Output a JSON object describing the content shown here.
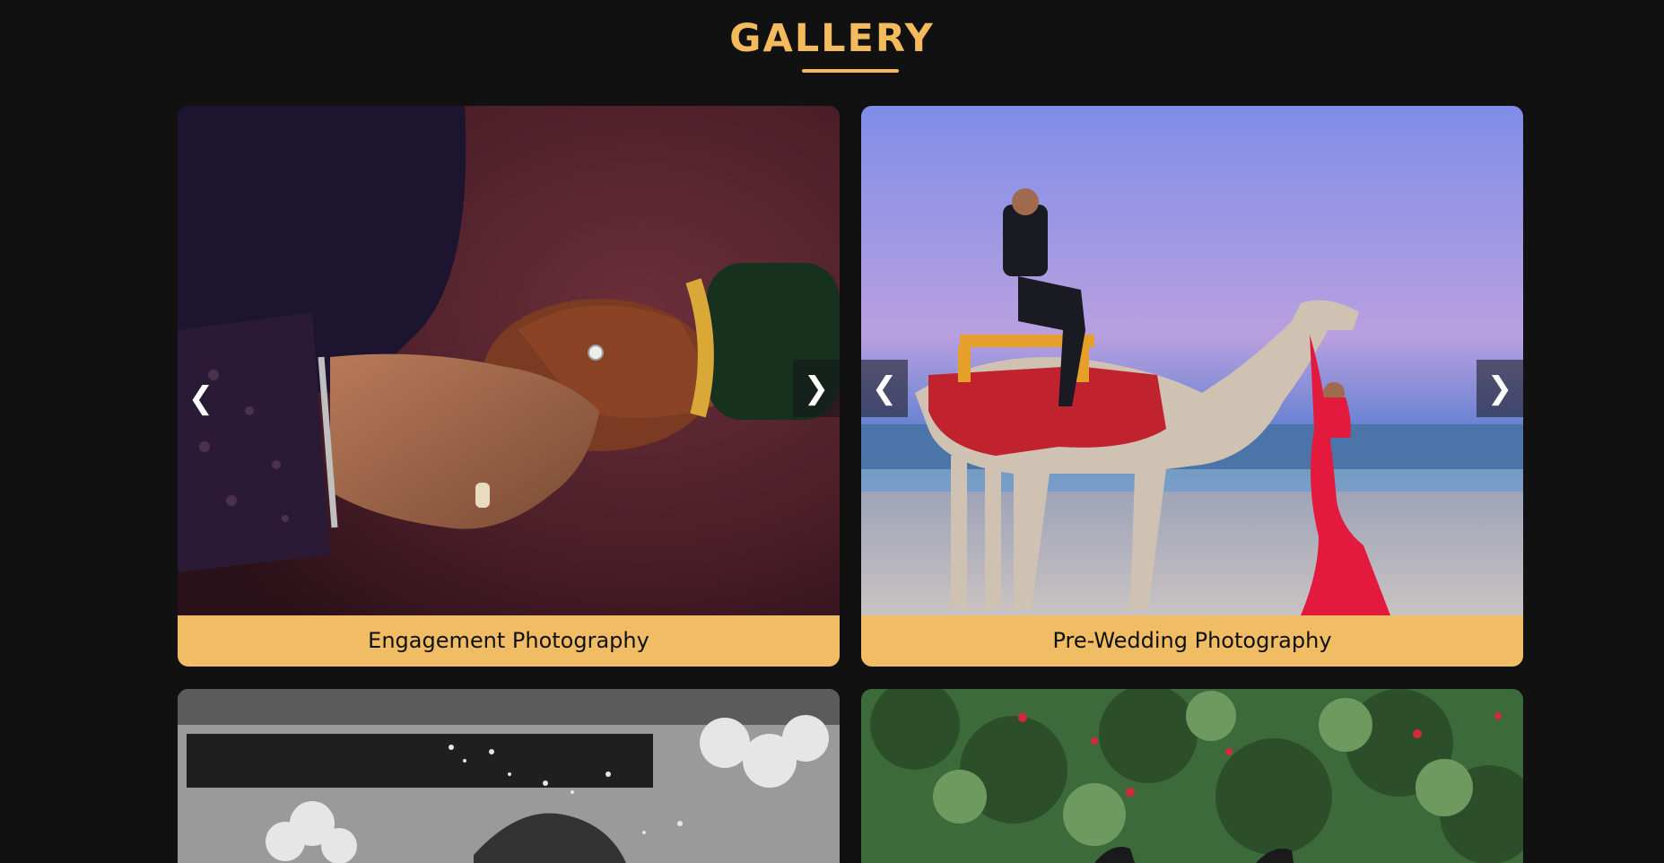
{
  "page": {
    "title": "GALLERY"
  },
  "gallery": {
    "items": [
      {
        "caption": "Engagement Photography",
        "prev": "❮",
        "next": "❯"
      },
      {
        "caption": "Pre-Wedding Photography",
        "prev": "❮",
        "next": "❯"
      },
      {
        "caption": ""
      },
      {
        "caption": ""
      }
    ]
  },
  "colors": {
    "accent": "#f3bb5e",
    "caption_bg": "#f0bd65",
    "background": "#111111"
  },
  "icons": {
    "prev": "chevron-left-icon",
    "next": "chevron-right-icon"
  }
}
